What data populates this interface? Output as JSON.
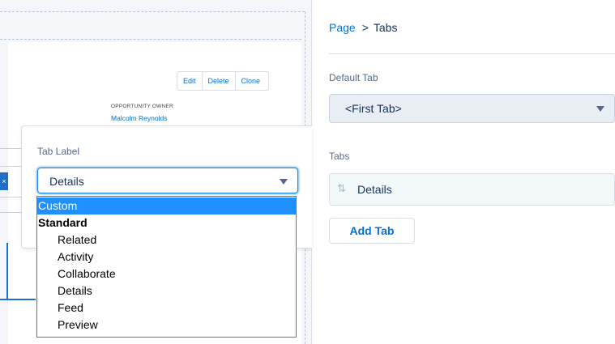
{
  "canvas": {
    "actions": [
      "Edit",
      "Delete",
      "Clone"
    ],
    "owner_label": "OPPORTUNITY OWNER",
    "owner_value": "Malcolm Reynolds",
    "close_glyph": "×"
  },
  "popover": {
    "field_label": "Tab Label",
    "selected_value": "Details",
    "options": [
      {
        "label": "Custom",
        "kind": "option",
        "selected": true
      },
      {
        "label": "Standard",
        "kind": "group"
      },
      {
        "label": "Related",
        "kind": "child"
      },
      {
        "label": "Activity",
        "kind": "child"
      },
      {
        "label": "Collaborate",
        "kind": "child"
      },
      {
        "label": "Details",
        "kind": "child"
      },
      {
        "label": "Feed",
        "kind": "child"
      },
      {
        "label": "Preview",
        "kind": "child"
      }
    ]
  },
  "panel": {
    "breadcrumb": {
      "parent": "Page",
      "separator": ">",
      "current": "Tabs"
    },
    "default_tab": {
      "label": "Default Tab",
      "value": "<First Tab>"
    },
    "tabs": {
      "label": "Tabs",
      "items": [
        {
          "name": "Details",
          "icon": "drag-sort-icon",
          "glyph": "⇅"
        }
      ]
    },
    "add_tab_label": "Add Tab"
  },
  "colors": {
    "link": "#0070d2",
    "text": "#16325c",
    "selected_option": "#1e90ff",
    "tab_item_bg": "#f1f9fb"
  }
}
